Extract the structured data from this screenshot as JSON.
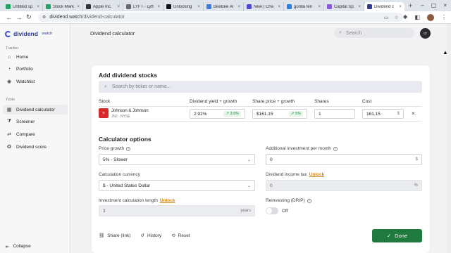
{
  "browser": {
    "tabs": [
      {
        "label": "Untitled sp",
        "color": "#1fa463"
      },
      {
        "label": "Stock Mark",
        "color": "#1fa463"
      },
      {
        "label": "Apple Inc.",
        "color": "#333333"
      },
      {
        "label": "LYFT - Lyft",
        "color": "#6a6a6a"
      },
      {
        "label": "Unlocking",
        "color": "#111111"
      },
      {
        "label": "BeeBee AI",
        "color": "#3c7be0"
      },
      {
        "label": "New | Cha",
        "color": "#4a4ad0"
      },
      {
        "label": "gorilla ten",
        "color": "#2b7de9"
      },
      {
        "label": "Capital Sp",
        "color": "#8a5ad8"
      },
      {
        "label": "Dividend c",
        "color": "#2f3b8f"
      }
    ],
    "url_host": "dividend.watch",
    "url_path": "/dividend-calculator"
  },
  "sidebar": {
    "logo_text": "dividend",
    "logo_sub": "watch",
    "tracker_label": "Tracker",
    "tracker_items": [
      {
        "label": "Home",
        "icon": "home-icon"
      },
      {
        "label": "Portfolio",
        "icon": "portfolio-icon"
      },
      {
        "label": "Watchlist",
        "icon": "eye-icon"
      }
    ],
    "tools_label": "Tools",
    "tools_items": [
      {
        "label": "Dividend calculator",
        "icon": "calculator-icon"
      },
      {
        "label": "Screener",
        "icon": "filter-icon"
      },
      {
        "label": "Compare",
        "icon": "compare-icon"
      },
      {
        "label": "Dividend score",
        "icon": "score-icon"
      }
    ],
    "collapse_label": "Collapse"
  },
  "header": {
    "title": "Dividend calculator",
    "search_placeholder": "Search",
    "avatar_initials": "cr"
  },
  "add_stocks": {
    "title": "Add dividend stocks",
    "search_placeholder": "Search by ticker or name...",
    "columns": [
      "Stock",
      "Dividend yield + growth",
      "Share price + growth",
      "Shares",
      "Cost"
    ],
    "row": {
      "name": "Johnson & Johnson",
      "ticker": "JNJ · NYSE",
      "yield": "2.92%",
      "yield_growth": "3.9%",
      "price": "$161.15",
      "price_growth": "5%",
      "shares": "1",
      "cost": "161,15",
      "cost_suffix": "$"
    }
  },
  "options": {
    "title": "Calculator options",
    "price_growth_label": "Price growth",
    "price_growth_value": "5% - Slower",
    "additional_label": "Additional investment per month",
    "additional_value": "0",
    "additional_suffix": "$",
    "currency_label": "Calculation currency",
    "currency_value": "$ - United States Dollar",
    "tax_label": "Dividend income tax",
    "tax_unlock": "Unlock",
    "tax_value": "0",
    "tax_suffix": "%",
    "length_label": "Investment calculation length",
    "length_unlock": "Unlock",
    "length_value": "3",
    "length_suffix": "years",
    "drip_label": "Reinvesting (DRIP)",
    "drip_state": "Off"
  },
  "actions": {
    "share": "Share (link)",
    "history": "History",
    "reset": "Reset",
    "done": "Done"
  }
}
